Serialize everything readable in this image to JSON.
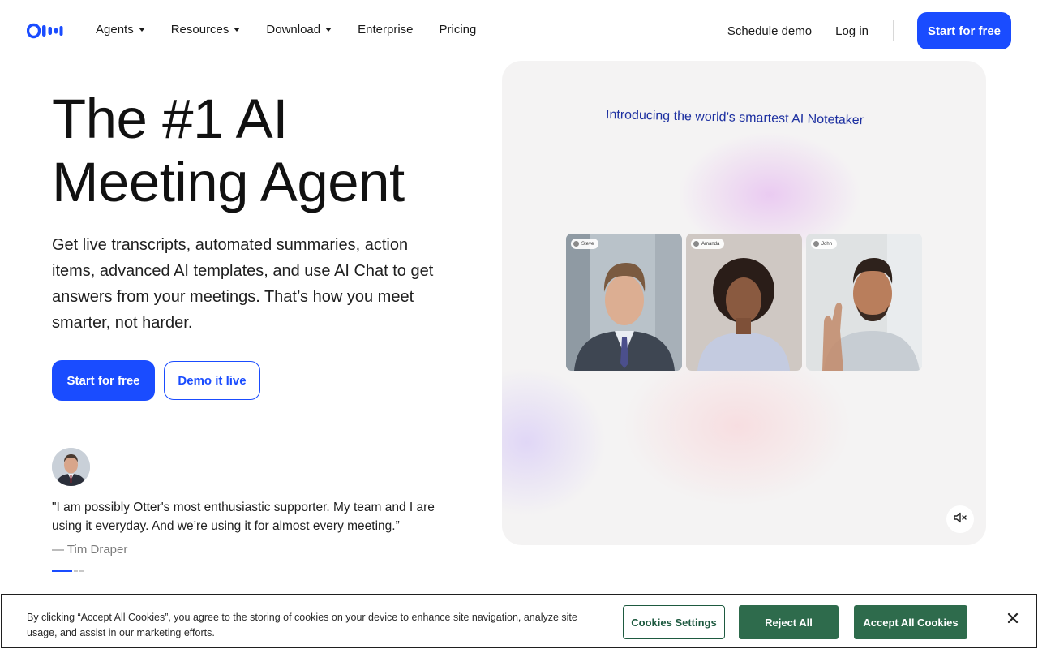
{
  "nav": {
    "logo_name": "Otter.ai",
    "links": [
      {
        "label": "Agents",
        "has_dropdown": true
      },
      {
        "label": "Resources",
        "has_dropdown": true
      },
      {
        "label": "Download",
        "has_dropdown": true
      },
      {
        "label": "Enterprise",
        "has_dropdown": false
      },
      {
        "label": "Pricing",
        "has_dropdown": false
      }
    ],
    "schedule_demo": "Schedule demo",
    "log_in": "Log in",
    "cta": "Start for free"
  },
  "hero": {
    "title_line1": "The #1 AI",
    "title_line2": "Meeting Agent",
    "subtitle": "Get live transcripts, automated summaries, action items, advanced AI templates, and use AI Chat to get answers from your meetings. That’s how you meet smarter, not harder.",
    "primary_cta": "Start for free",
    "secondary_cta": "Demo it live"
  },
  "testimonial": {
    "quote": "\"I am possibly Otter's most enthusiastic supporter. My team and I are using it everyday. And we’re using it for almost every meeting.”",
    "author": "— Tim Draper",
    "carousel_total": 3,
    "carousel_active": 1
  },
  "video": {
    "caption": "Introducing the world’s smartest AI Notetaker",
    "participants": [
      "Steve",
      "Amanda",
      "John"
    ],
    "mute_icon": "speaker-muted-icon"
  },
  "cookie": {
    "text": "By clicking “Accept All Cookies”, you agree to the storing of cookies on your device to enhance site navigation, analyze site usage, and assist in our marketing efforts.",
    "settings": "Cookies Settings",
    "reject": "Reject All",
    "accept": "Accept All Cookies"
  },
  "colors": {
    "brand_blue": "#1a4cff",
    "cookie_green": "#2e6b4c",
    "caption_blue": "#1c2fa0"
  }
}
